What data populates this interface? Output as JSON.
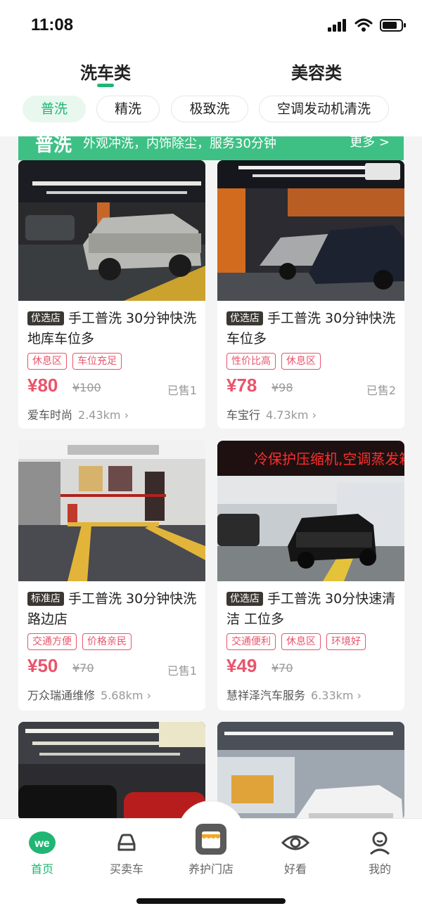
{
  "status_bar": {
    "time": "11:08"
  },
  "top_tabs": [
    {
      "label": "洗车类",
      "active": true
    },
    {
      "label": "美容类",
      "active": false
    }
  ],
  "chips": [
    {
      "label": "普洗",
      "active": true
    },
    {
      "label": "精洗",
      "active": false
    },
    {
      "label": "极致洗",
      "active": false
    },
    {
      "label": "空调发动机清洗",
      "active": false
    }
  ],
  "banner": {
    "title": "普洗",
    "description": "外观冲洗，内饰除尘，服务30分钟",
    "more": "更多 >"
  },
  "cards": [
    {
      "badge": "优选店",
      "title": "手工普洗 30分钟快洗 地库车位多",
      "tags": [
        "休息区",
        "车位充足"
      ],
      "price": "¥80",
      "original_price": "¥100",
      "sold": "已售1",
      "shop": "爱车时尚",
      "distance": "2.43km ›",
      "photo_icon": "car-photo-icon"
    },
    {
      "badge": "优选店",
      "title": "手工普洗 30分钟快洗 车位多",
      "tags": [
        "性价比高",
        "休息区"
      ],
      "price": "¥78",
      "original_price": "¥98",
      "sold": "已售2",
      "shop": "车宝行",
      "distance": "4.73km ›",
      "photo_icon": "car-photo-icon"
    },
    {
      "badge": "标准店",
      "title": "手工普洗 30分钟快洗 路边店",
      "tags": [
        "交通方便",
        "价格亲民"
      ],
      "price": "¥50",
      "original_price": "¥70",
      "sold": "已售1",
      "shop": "万众瑞通维修",
      "distance": "5.68km ›",
      "photo_icon": "garage-photo-icon"
    },
    {
      "badge": "优选店",
      "title": "手工普洗 30分快速清洁 工位多",
      "tags": [
        "交通便利",
        "休息区",
        "环境好"
      ],
      "price": "¥49",
      "original_price": "¥70",
      "sold": "",
      "shop": "慧祥泽汽车服务",
      "distance": "6.33km ›",
      "photo_icon": "car-photo-icon"
    },
    {
      "photo_icon": "car-photo-icon"
    },
    {
      "photo_icon": "car-photo-icon"
    }
  ],
  "photo_signage": "冷保护压缩机,空调蒸发箱清",
  "bottom_nav": [
    {
      "label": "首页",
      "icon": "we-logo-icon",
      "active": true
    },
    {
      "label": "买卖车",
      "icon": "car-icon",
      "active": false
    },
    {
      "label": "养护门店",
      "icon": "store-icon",
      "active": false
    },
    {
      "label": "好看",
      "icon": "eye-icon",
      "active": false
    },
    {
      "label": "我的",
      "icon": "person-icon",
      "active": false
    }
  ],
  "colors": {
    "accent": "#21b573",
    "banner": "#3ec085",
    "price": "#e9546b",
    "badge": "#3b3833"
  }
}
